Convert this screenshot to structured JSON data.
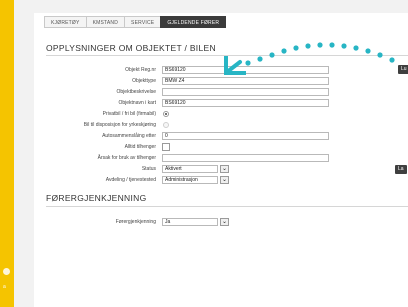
{
  "tabs": [
    {
      "label": "KJØRETØY"
    },
    {
      "label": "KMSTAND"
    },
    {
      "label": "SERVICE"
    },
    {
      "label": "GJELDENDE FØRER"
    }
  ],
  "section1": {
    "title": "OPPLYSNINGER OM OBJEKTET / BILEN",
    "fields": {
      "reg_nr": {
        "label": "Objekt Reg.nr",
        "value": "BS69120"
      },
      "objekttype": {
        "label": "Objekttype",
        "value": "BMW Z4"
      },
      "beskrivelse": {
        "label": "Objektbeskrivelse",
        "value": ""
      },
      "objektnavn": {
        "label": "Objektnavn i kart",
        "value": "BS69120"
      },
      "privatbil": {
        "label": "Privatbil / fri bil (firmabil)"
      },
      "disposisjon": {
        "label": "Bil til disposisjon for yrkeskjøring"
      },
      "autosammen": {
        "label": "Autosammenslåing etter",
        "value": "0"
      },
      "tilhenger": {
        "label": "Alltid tilhenger"
      },
      "aarsak": {
        "label": "Årsak for bruk av tilhenger",
        "value": ""
      },
      "status": {
        "label": "Status",
        "value": "Aktivert"
      },
      "avdeling": {
        "label": "Avdeling / tjenestested",
        "value": "Administrasjon"
      }
    }
  },
  "section2": {
    "title": "FØRERGJENKJENNING",
    "fields": {
      "forergjenkjenning": {
        "label": "Førergjenkjenning",
        "value": "Ja"
      }
    }
  },
  "side_buttons": {
    "top": "Lu",
    "middle": "La"
  },
  "sidebar": {
    "bottom_text": "a"
  },
  "colors": {
    "brand_yellow": "#f5c400",
    "accent_teal": "#27b5c4",
    "active_tab": "#3b3b3b"
  }
}
